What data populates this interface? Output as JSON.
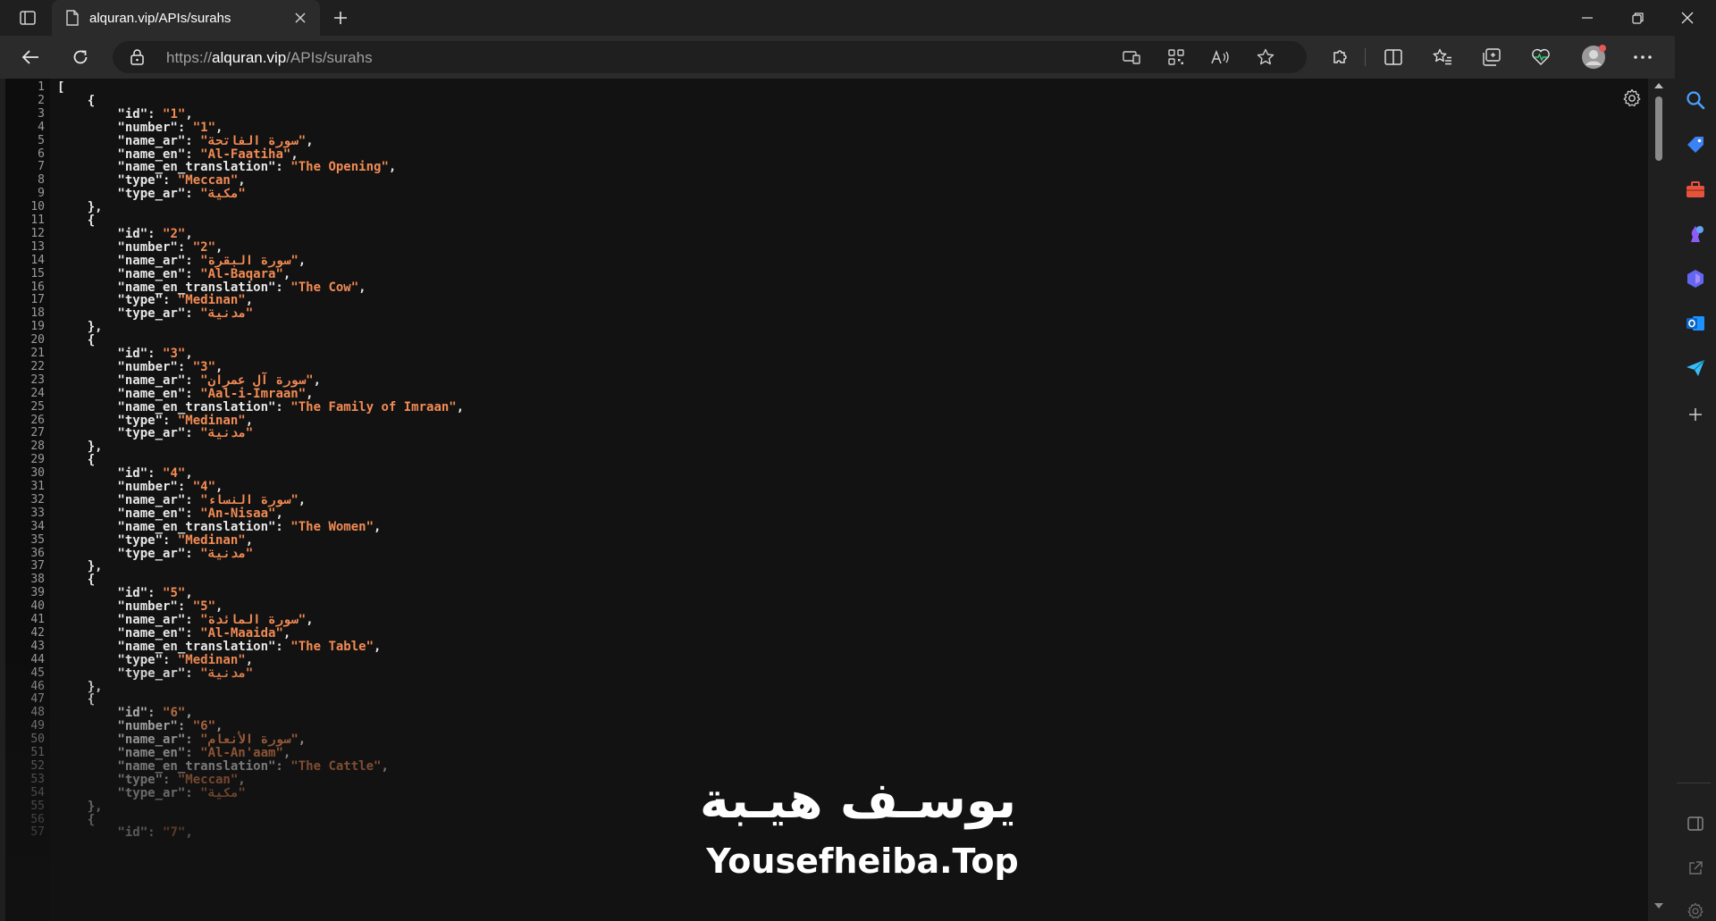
{
  "tab": {
    "title": "alquran.vip/APIs/surahs"
  },
  "address": {
    "scheme": "https://",
    "host": "alquran.vip",
    "path": "/APIs/surahs"
  },
  "colors": {
    "string": "#f28b54",
    "key": "#e8e8e8",
    "line_number": "#9a9a9a",
    "background": "#121212",
    "accent": "#2f9bff"
  },
  "json_lines": [
    [
      {
        "t": "["
      }
    ],
    [
      {
        "t": "    {"
      }
    ],
    [
      {
        "t": "        \"id\": "
      },
      {
        "s": "\"1\""
      },
      {
        "t": ","
      }
    ],
    [
      {
        "t": "        \"number\": "
      },
      {
        "s": "\"1\""
      },
      {
        "t": ","
      }
    ],
    [
      {
        "t": "        \"name_ar\": "
      },
      {
        "s": "\"سورة الفاتحة\""
      },
      {
        "t": ","
      }
    ],
    [
      {
        "t": "        \"name_en\": "
      },
      {
        "s": "\"Al-Faatiha\""
      },
      {
        "t": ","
      }
    ],
    [
      {
        "t": "        \"name_en_translation\": "
      },
      {
        "s": "\"The Opening\""
      },
      {
        "t": ","
      }
    ],
    [
      {
        "t": "        \"type\": "
      },
      {
        "s": "\"Meccan\""
      },
      {
        "t": ","
      }
    ],
    [
      {
        "t": "        \"type_ar\": "
      },
      {
        "s": "\"مكية\""
      }
    ],
    [
      {
        "t": "    },"
      }
    ],
    [
      {
        "t": "    {"
      }
    ],
    [
      {
        "t": "        \"id\": "
      },
      {
        "s": "\"2\""
      },
      {
        "t": ","
      }
    ],
    [
      {
        "t": "        \"number\": "
      },
      {
        "s": "\"2\""
      },
      {
        "t": ","
      }
    ],
    [
      {
        "t": "        \"name_ar\": "
      },
      {
        "s": "\"سورة البقرة\""
      },
      {
        "t": ","
      }
    ],
    [
      {
        "t": "        \"name_en\": "
      },
      {
        "s": "\"Al-Baqara\""
      },
      {
        "t": ","
      }
    ],
    [
      {
        "t": "        \"name_en_translation\": "
      },
      {
        "s": "\"The Cow\""
      },
      {
        "t": ","
      }
    ],
    [
      {
        "t": "        \"type\": "
      },
      {
        "s": "\"Medinan\""
      },
      {
        "t": ","
      }
    ],
    [
      {
        "t": "        \"type_ar\": "
      },
      {
        "s": "\"مدنية\""
      }
    ],
    [
      {
        "t": "    },"
      }
    ],
    [
      {
        "t": "    {"
      }
    ],
    [
      {
        "t": "        \"id\": "
      },
      {
        "s": "\"3\""
      },
      {
        "t": ","
      }
    ],
    [
      {
        "t": "        \"number\": "
      },
      {
        "s": "\"3\""
      },
      {
        "t": ","
      }
    ],
    [
      {
        "t": "        \"name_ar\": "
      },
      {
        "s": "\"سورة آل عمران\""
      },
      {
        "t": ","
      }
    ],
    [
      {
        "t": "        \"name_en\": "
      },
      {
        "s": "\"Aal-i-Imraan\""
      },
      {
        "t": ","
      }
    ],
    [
      {
        "t": "        \"name_en_translation\": "
      },
      {
        "s": "\"The Family of Imraan\""
      },
      {
        "t": ","
      }
    ],
    [
      {
        "t": "        \"type\": "
      },
      {
        "s": "\"Medinan\""
      },
      {
        "t": ","
      }
    ],
    [
      {
        "t": "        \"type_ar\": "
      },
      {
        "s": "\"مدنية\""
      }
    ],
    [
      {
        "t": "    },"
      }
    ],
    [
      {
        "t": "    {"
      }
    ],
    [
      {
        "t": "        \"id\": "
      },
      {
        "s": "\"4\""
      },
      {
        "t": ","
      }
    ],
    [
      {
        "t": "        \"number\": "
      },
      {
        "s": "\"4\""
      },
      {
        "t": ","
      }
    ],
    [
      {
        "t": "        \"name_ar\": "
      },
      {
        "s": "\"سورة النساء\""
      },
      {
        "t": ","
      }
    ],
    [
      {
        "t": "        \"name_en\": "
      },
      {
        "s": "\"An-Nisaa\""
      },
      {
        "t": ","
      }
    ],
    [
      {
        "t": "        \"name_en_translation\": "
      },
      {
        "s": "\"The Women\""
      },
      {
        "t": ","
      }
    ],
    [
      {
        "t": "        \"type\": "
      },
      {
        "s": "\"Medinan\""
      },
      {
        "t": ","
      }
    ],
    [
      {
        "t": "        \"type_ar\": "
      },
      {
        "s": "\"مدنية\""
      }
    ],
    [
      {
        "t": "    },"
      }
    ],
    [
      {
        "t": "    {"
      }
    ],
    [
      {
        "t": "        \"id\": "
      },
      {
        "s": "\"5\""
      },
      {
        "t": ","
      }
    ],
    [
      {
        "t": "        \"number\": "
      },
      {
        "s": "\"5\""
      },
      {
        "t": ","
      }
    ],
    [
      {
        "t": "        \"name_ar\": "
      },
      {
        "s": "\"سورة المائدة\""
      },
      {
        "t": ","
      }
    ],
    [
      {
        "t": "        \"name_en\": "
      },
      {
        "s": "\"Al-Maaida\""
      },
      {
        "t": ","
      }
    ],
    [
      {
        "t": "        \"name_en_translation\": "
      },
      {
        "s": "\"The Table\""
      },
      {
        "t": ","
      }
    ],
    [
      {
        "t": "        \"type\": "
      },
      {
        "s": "\"Medinan\""
      },
      {
        "t": ","
      }
    ],
    [
      {
        "t": "        \"type_ar\": "
      },
      {
        "s": "\"مدنية\""
      }
    ],
    [
      {
        "t": "    },"
      }
    ],
    [
      {
        "t": "    {"
      }
    ],
    [
      {
        "t": "        \"id\": "
      },
      {
        "s": "\"6\""
      },
      {
        "t": ","
      }
    ],
    [
      {
        "t": "        \"number\": "
      },
      {
        "s": "\"6\""
      },
      {
        "t": ","
      }
    ],
    [
      {
        "t": "        \"name_ar\": "
      },
      {
        "s": "\"سورة الأنعام\""
      },
      {
        "t": ","
      }
    ],
    [
      {
        "t": "        \"name_en\": "
      },
      {
        "s": "\"Al-An'aam\""
      },
      {
        "t": ","
      }
    ],
    [
      {
        "t": "        \"name_en_translation\": "
      },
      {
        "s": "\"The Cattle\""
      },
      {
        "t": ","
      }
    ],
    [
      {
        "t": "        \"type\": "
      },
      {
        "s": "\"Meccan\""
      },
      {
        "t": ","
      }
    ],
    [
      {
        "t": "        \"type_ar\": "
      },
      {
        "s": "\"مكية\""
      }
    ],
    [
      {
        "t": "    },"
      }
    ],
    [
      {
        "t": "    {"
      }
    ],
    [
      {
        "t": "        \"id\": "
      },
      {
        "s": "\"7\""
      },
      {
        "t": ","
      }
    ]
  ],
  "watermark": {
    "arabic": "يوسـف هيـبة",
    "latin": "Yousefheiba.Top"
  }
}
